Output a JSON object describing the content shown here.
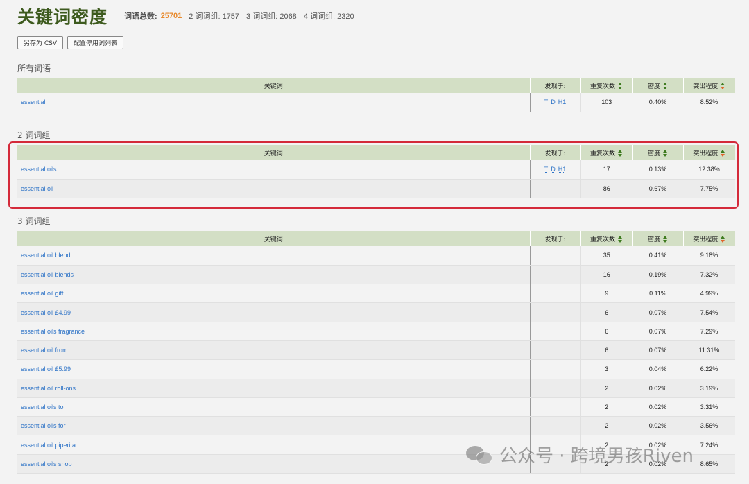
{
  "header": {
    "title": "关键词密度",
    "total_label": "词语总数:",
    "total_value": "25701",
    "group2": "2 词词组: 1757",
    "group3": "3 词词组: 2068",
    "group4": "4 词词组: 2320"
  },
  "toolbar": {
    "save_csv": "另存为 CSV",
    "config_stopwords": "配置停用词列表"
  },
  "columns": {
    "keyword": "关键词",
    "found_in": "发现于:",
    "repeats": "重复次数",
    "density": "密度",
    "prominence": "突出程度"
  },
  "colors": {
    "title": "#3d5a1e",
    "total": "#e8892b",
    "header_bg": "#d3dfc5",
    "link": "#2f74c7",
    "highlight": "#d42a3a"
  },
  "sections": {
    "all": {
      "title": "所有词语",
      "rows": [
        {
          "keyword": "essential",
          "found": [
            "T",
            "D",
            "H1"
          ],
          "count": "103",
          "density": "0.40%",
          "prominence": "8.52%"
        }
      ]
    },
    "two": {
      "title": "2 词词组",
      "rows": [
        {
          "keyword": "essential oils",
          "found": [
            "T",
            "D",
            "H1"
          ],
          "count": "17",
          "density": "0.13%",
          "prominence": "12.38%"
        },
        {
          "keyword": "essential oil",
          "found": [],
          "count": "86",
          "density": "0.67%",
          "prominence": "7.75%"
        }
      ]
    },
    "three": {
      "title": "3 词词组",
      "rows": [
        {
          "keyword": "essential oil blend",
          "count": "35",
          "density": "0.41%",
          "prominence": "9.18%"
        },
        {
          "keyword": "essential oil blends",
          "count": "16",
          "density": "0.19%",
          "prominence": "7.32%"
        },
        {
          "keyword": "essential oil gift",
          "count": "9",
          "density": "0.11%",
          "prominence": "4.99%"
        },
        {
          "keyword": "essential oil £4.99",
          "count": "6",
          "density": "0.07%",
          "prominence": "7.54%"
        },
        {
          "keyword": "essential oils fragrance",
          "count": "6",
          "density": "0.07%",
          "prominence": "7.29%"
        },
        {
          "keyword": "essential oil from",
          "count": "6",
          "density": "0.07%",
          "prominence": "11.31%"
        },
        {
          "keyword": "essential oil £5.99",
          "count": "3",
          "density": "0.04%",
          "prominence": "6.22%"
        },
        {
          "keyword": "essential oil roll-ons",
          "count": "2",
          "density": "0.02%",
          "prominence": "3.19%"
        },
        {
          "keyword": "essential oils to",
          "count": "2",
          "density": "0.02%",
          "prominence": "3.31%"
        },
        {
          "keyword": "essential oils for",
          "count": "2",
          "density": "0.02%",
          "prominence": "3.56%"
        },
        {
          "keyword": "essential oil piperita",
          "count": "2",
          "density": "0.02%",
          "prominence": "7.24%"
        },
        {
          "keyword": "essential oils shop",
          "count": "2",
          "density": "0.02%",
          "prominence": "8.65%"
        }
      ]
    }
  },
  "watermark": "公众号 · 跨境男孩Riven"
}
